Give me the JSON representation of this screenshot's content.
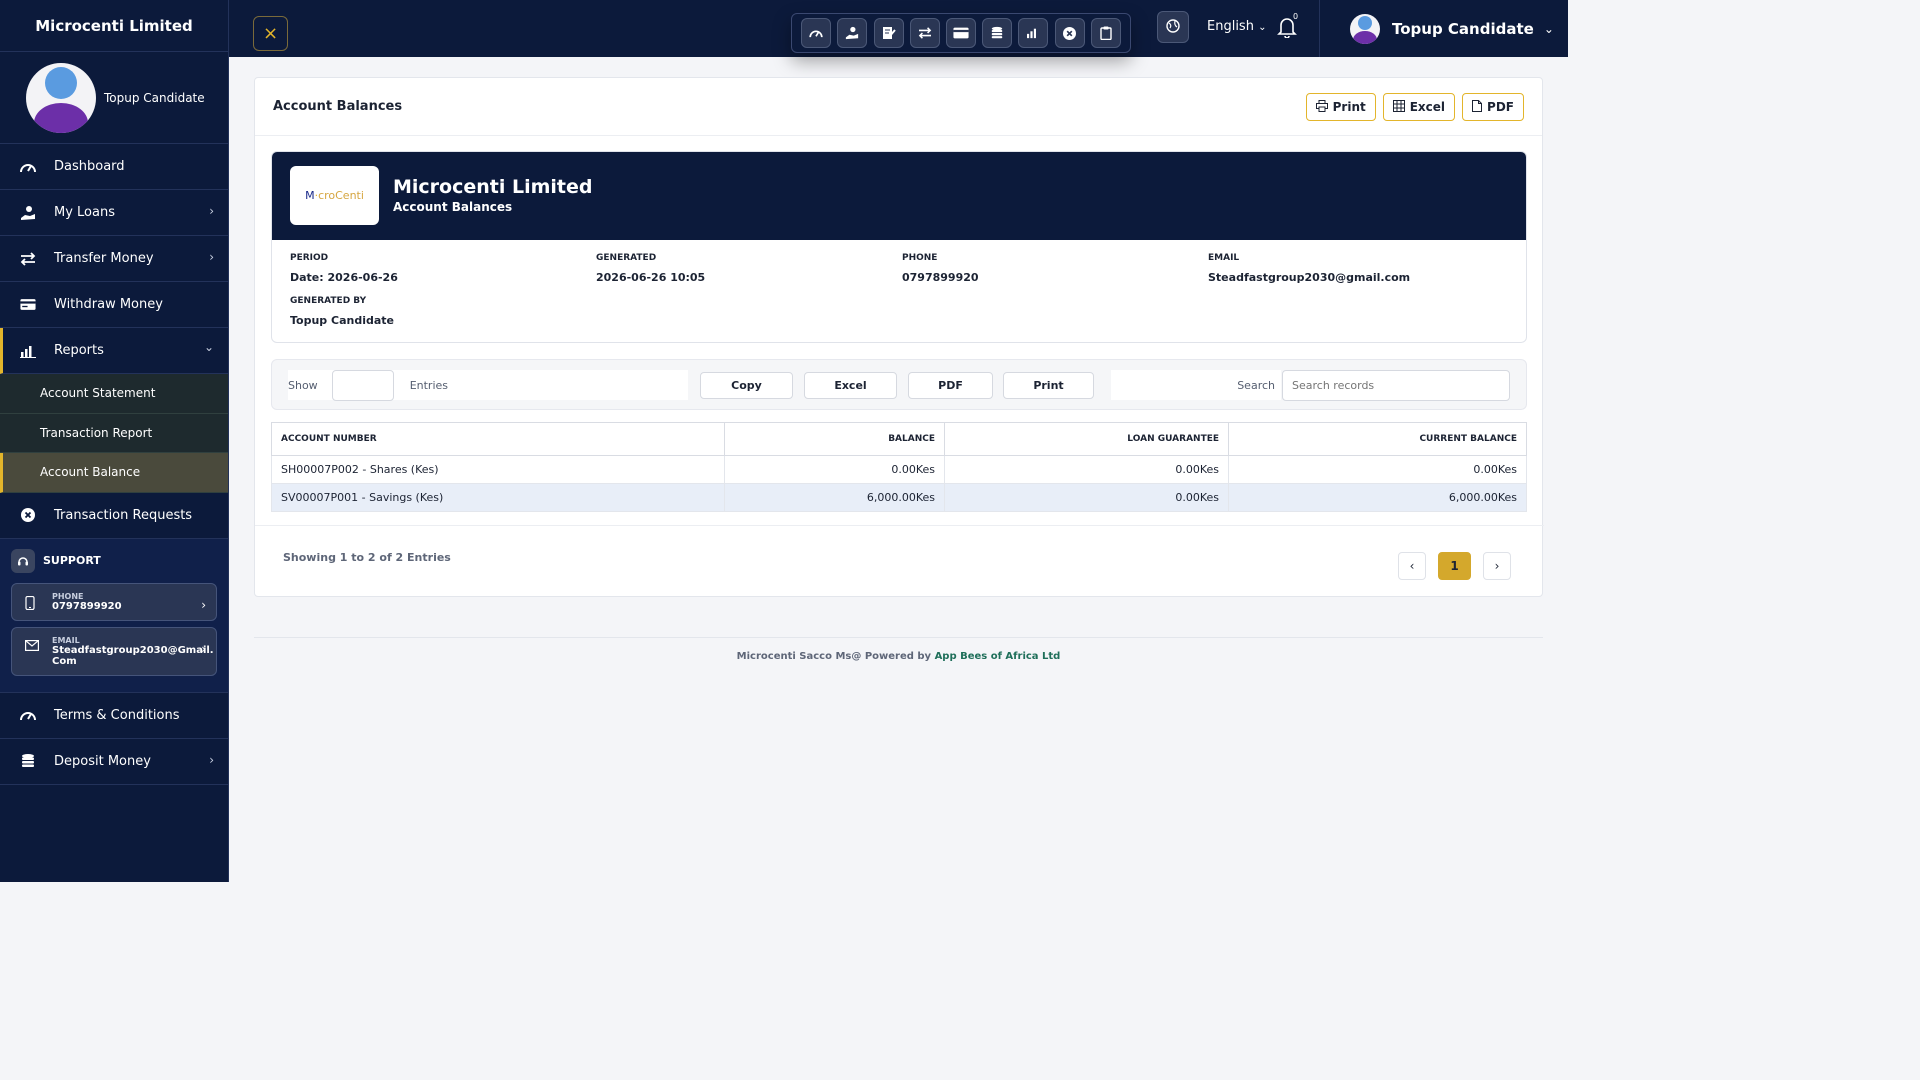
{
  "colors": {
    "navy": "#0c1a3b",
    "accent": "#e3b52b",
    "active_page": "#d4a82c"
  },
  "sidebar": {
    "brand": "Microcenti Limited",
    "user_name": "Topup Candidate",
    "items": [
      {
        "label": "Dashboard",
        "icon": "dashboard-icon"
      },
      {
        "label": "My Loans",
        "icon": "loan-hand-icon"
      },
      {
        "label": "Transfer Money",
        "icon": "transfer-icon"
      },
      {
        "label": "Withdraw Money",
        "icon": "card-icon"
      },
      {
        "label": "Reports",
        "icon": "chart-icon"
      }
    ],
    "reports_sub": [
      "Account Statement",
      "Transaction Report",
      "Account Balance"
    ],
    "transaction_requests": "Transaction Requests",
    "support": {
      "title": "SUPPORT",
      "phone_label": "PHONE",
      "phone": "0797899920",
      "email_label": "EMAIL",
      "email_line1": "Steadfastgroup2030@Gmail.",
      "email_line2": "Com"
    },
    "terms": "Terms & Conditions",
    "deposit": "Deposit Money"
  },
  "topbar": {
    "language": "English",
    "notification_count": "0",
    "user_name": "Topup Candidate",
    "quick_icons": [
      "dashboard-icon",
      "loan-hand-icon",
      "apply-icon",
      "transfer-icon",
      "card-icon",
      "coins-icon",
      "chart-icon",
      "cancel-icon",
      "clipboard-icon"
    ]
  },
  "card": {
    "title": "Account Balances",
    "print": "Print",
    "excel": "Excel",
    "pdf": "PDF"
  },
  "report": {
    "logo_text_a": "M",
    "logo_text_b": "croCenti",
    "company": "Microcenti Limited",
    "subtitle": "Account Balances",
    "period_label": "PERIOD",
    "period_value": "Date: 2026-06-26",
    "generated_label": "GENERATED",
    "generated_value": "2026-06-26 10:05",
    "phone_label": "PHONE",
    "phone_value": "0797899920",
    "email_label": "EMAIL",
    "email_value": "Steadfastgroup2030@gmail.com",
    "generated_by_label": "GENERATED BY",
    "generated_by_value": "Topup Candidate"
  },
  "toolbar": {
    "show": "Show",
    "entries": "Entries",
    "copy": "Copy",
    "excel": "Excel",
    "pdf": "PDF",
    "print": "Print",
    "search_label": "Search",
    "search_placeholder": "Search records"
  },
  "table": {
    "headers": [
      "ACCOUNT NUMBER",
      "BALANCE",
      "LOAN GUARANTEE",
      "CURRENT BALANCE"
    ],
    "rows": [
      [
        "SH00007P002 - Shares (Kes)",
        "0.00Kes",
        "0.00Kes",
        "0.00Kes"
      ],
      [
        "SV00007P001 - Savings (Kes)",
        "6,000.00Kes",
        "0.00Kes",
        "6,000.00Kes"
      ]
    ]
  },
  "pagination": {
    "showing": "Showing 1 to 2 of 2 Entries",
    "current": "1"
  },
  "footer": {
    "text": "Microcenti Sacco Ms@ Powered by ",
    "link": "App Bees of Africa Ltd"
  }
}
